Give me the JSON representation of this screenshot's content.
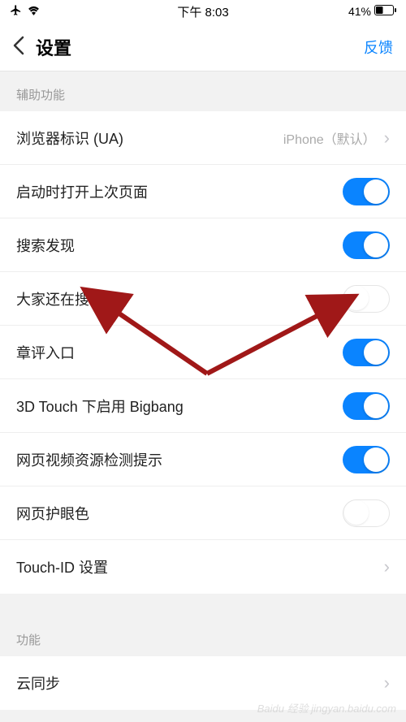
{
  "status_bar": {
    "time": "下午 8:03",
    "battery": "41%"
  },
  "nav": {
    "title": "设置",
    "feedback": "反馈"
  },
  "section1_header": "辅助功能",
  "rows": {
    "ua": {
      "label": "浏览器标识 (UA)",
      "value": "iPhone（默认）"
    },
    "restore": {
      "label": "启动时打开上次页面"
    },
    "search_discover": {
      "label": "搜索发现"
    },
    "others_search": {
      "label": "大家还在搜"
    },
    "review_entry": {
      "label": "章评入口"
    },
    "bigbang": {
      "label": "3D Touch 下启用 Bigbang"
    },
    "video_detect": {
      "label": "网页视频资源检测提示"
    },
    "eye_protect": {
      "label": "网页护眼色"
    },
    "touch_id": {
      "label": "Touch-ID 设置"
    }
  },
  "section2_header": "功能",
  "rows2": {
    "cloud_sync": {
      "label": "云同步"
    }
  },
  "watermark": "Baidu 经验 jingyan.baidu.com"
}
